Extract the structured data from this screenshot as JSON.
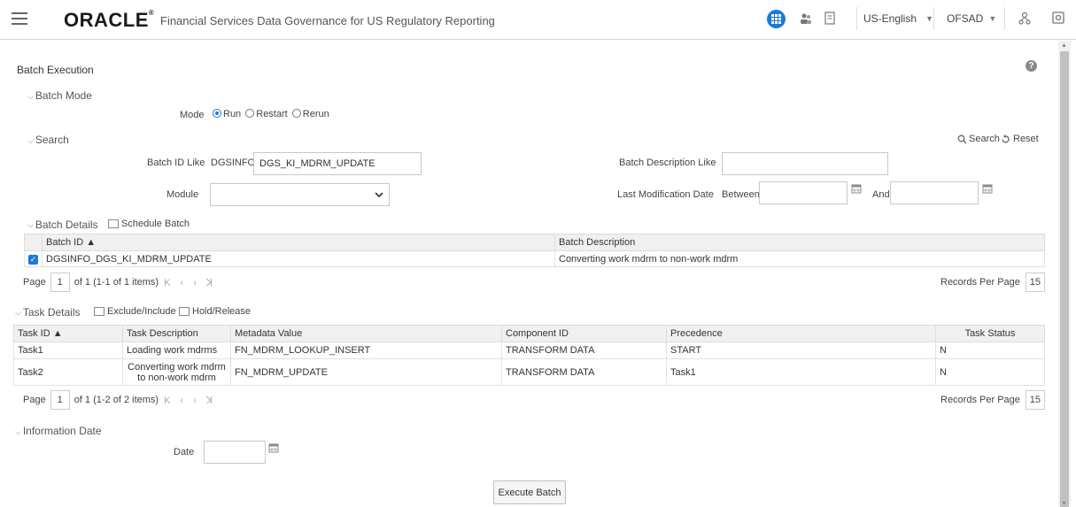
{
  "header": {
    "logo": "ORACLE",
    "app_title": "Financial Services Data Governance for US Regulatory Reporting",
    "language": "US-English",
    "user": "OFSAD"
  },
  "page": {
    "title": "Batch Execution"
  },
  "batch_mode": {
    "section_label": "Batch Mode",
    "mode_label": "Mode",
    "options": [
      "Run",
      "Restart",
      "Rerun"
    ],
    "selected": "Run"
  },
  "search": {
    "section_label": "Search",
    "search_button": "Search",
    "reset_button": "Reset",
    "batch_id_label": "Batch ID Like",
    "batch_id_prefix": "DGSINFO_",
    "batch_id_value": "DGS_KI_MDRM_UPDATE",
    "batch_desc_label": "Batch Description Like",
    "batch_desc_value": "",
    "module_label": "Module",
    "module_value": "",
    "last_mod_label": "Last Modification Date",
    "between_label": "Between",
    "and_label": "And"
  },
  "batch_details": {
    "section_label": "Batch Details",
    "schedule_button": "Schedule Batch",
    "columns": [
      "Batch ID",
      "Batch Description"
    ],
    "rows": [
      {
        "batch_id": "DGSINFO_DGS_KI_MDRM_UPDATE",
        "description": "Converting work mdrm to non-work mdrm"
      }
    ],
    "page_label": "Page",
    "page_number": "1",
    "page_info": "of 1 (1-1 of 1 items)",
    "rpp_label": "Records Per Page",
    "rpp_value": "15"
  },
  "task_details": {
    "section_label": "Task Details",
    "exclude_button": "Exclude/Include",
    "hold_button": "Hold/Release",
    "columns": [
      "Task ID",
      "Task Description",
      "Metadata Value",
      "Component ID",
      "Precedence",
      "Task Status"
    ],
    "rows": [
      {
        "task_id": "Task1",
        "description": "Loading work mdrms",
        "metadata": "FN_MDRM_LOOKUP_INSERT",
        "component": "TRANSFORM DATA",
        "precedence": "START",
        "status": "N"
      },
      {
        "task_id": "Task2",
        "description": "Converting work mdrm to non-work mdrm",
        "metadata": "FN_MDRM_UPDATE",
        "component": "TRANSFORM DATA",
        "precedence": "Task1",
        "status": "N"
      }
    ],
    "page_label": "Page",
    "page_number": "1",
    "page_info": "of 1 (1-2 of 2 items)",
    "rpp_label": "Records Per Page",
    "rpp_value": "15"
  },
  "information_date": {
    "section_label": "Information Date",
    "date_label": "Date",
    "date_value": ""
  },
  "execute_button": "Execute Batch",
  "colors": {
    "accent": "#1a7ad9",
    "header_bg": "#f0f0f0"
  }
}
